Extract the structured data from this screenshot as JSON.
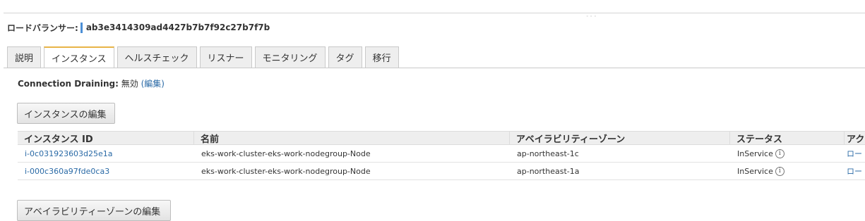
{
  "drag_handle": "◦◦◦",
  "load_balancer": {
    "label": "ロードバランサー:",
    "id": "ab3e3414309ad4427b7b7f92c27b7f7b"
  },
  "tabs": [
    {
      "label": "説明",
      "active": false
    },
    {
      "label": "インスタンス",
      "active": true
    },
    {
      "label": "ヘルスチェック",
      "active": false
    },
    {
      "label": "リスナー",
      "active": false
    },
    {
      "label": "モニタリング",
      "active": false
    },
    {
      "label": "タグ",
      "active": false
    },
    {
      "label": "移行",
      "active": false
    }
  ],
  "connection_draining": {
    "label": "Connection Draining:",
    "value": "無効",
    "edit_link": "(編集)"
  },
  "edit_instances_button": "インスタンスの編集",
  "table": {
    "headers": [
      "インスタンス ID",
      "名前",
      "アベイラビリティーゾーン",
      "ステータス",
      "アク"
    ],
    "rows": [
      {
        "id": "i-0c031923603d25e1a",
        "name": "eks-work-cluster-eks-work-nodegroup-Node",
        "az": "ap-northeast-1c",
        "status": "InService",
        "action": "ロー"
      },
      {
        "id": "i-000c360a97fde0ca3",
        "name": "eks-work-cluster-eks-work-nodegroup-Node",
        "az": "ap-northeast-1a",
        "status": "InService",
        "action": "ロー"
      }
    ]
  },
  "edit_az_button": "アベイラビリティーゾーンの編集",
  "icons": {
    "status_info": "info-icon"
  },
  "colors": {
    "link": "#2a6aa6",
    "active_tab_accent": "#e8b447",
    "lb_marker": "#4c8fd6"
  }
}
